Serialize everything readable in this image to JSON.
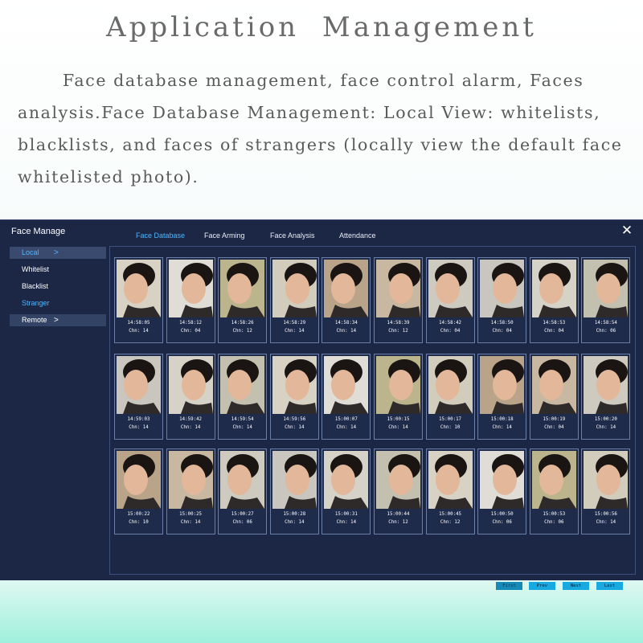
{
  "banner": {
    "title": "Application  Management",
    "description": "Face database management, face control alarm, Faces analysis.Face Database Management: Local View: whitelists, blacklists, and faces of strangers (locally view the default face whitelisted photo)."
  },
  "window": {
    "title": "Face Manage",
    "close_icon": "close-icon"
  },
  "tabs": [
    {
      "label": "Face Database",
      "active": true
    },
    {
      "label": "Face Arming",
      "active": false
    },
    {
      "label": "Face Analysis",
      "active": false
    },
    {
      "label": "Attendance",
      "active": false
    }
  ],
  "sidebar": {
    "items": [
      {
        "label": "Local",
        "chevron": ">"
      },
      {
        "label": "Whitelist"
      },
      {
        "label": "Blacklist"
      },
      {
        "label": "Stranger"
      },
      {
        "label": "Remote",
        "chevron": ">"
      }
    ]
  },
  "faces": [
    {
      "time": "14:58:05",
      "chn": "Chn: 14"
    },
    {
      "time": "14:58:12",
      "chn": "Chn: 04"
    },
    {
      "time": "14:58:26",
      "chn": "Chn: 12"
    },
    {
      "time": "14:58:29",
      "chn": "Chn: 14"
    },
    {
      "time": "14:58:34",
      "chn": "Chn: 14"
    },
    {
      "time": "14:58:39",
      "chn": "Chn: 12"
    },
    {
      "time": "14:58:42",
      "chn": "Chn: 04"
    },
    {
      "time": "14:58:50",
      "chn": "Chn: 04"
    },
    {
      "time": "14:58:53",
      "chn": "Chn: 04"
    },
    {
      "time": "14:58:54",
      "chn": "Chn: 06"
    },
    {
      "time": "14:59:03",
      "chn": "Chn: 14"
    },
    {
      "time": "14:59:42",
      "chn": "Chn: 14"
    },
    {
      "time": "14:59:54",
      "chn": "Chn: 14"
    },
    {
      "time": "14:59:56",
      "chn": "Chn: 14"
    },
    {
      "time": "15:00:07",
      "chn": "Chn: 14"
    },
    {
      "time": "15:00:15",
      "chn": "Chn: 14"
    },
    {
      "time": "15:00:17",
      "chn": "Chn: 10"
    },
    {
      "time": "15:00:18",
      "chn": "Chn: 14"
    },
    {
      "time": "15:00:19",
      "chn": "Chn: 04"
    },
    {
      "time": "15:00:20",
      "chn": "Chn: 14"
    },
    {
      "time": "15:00:22",
      "chn": "Chn: 10"
    },
    {
      "time": "15:00:25",
      "chn": "Chn: 14"
    },
    {
      "time": "15:00:27",
      "chn": "Chn: 06"
    },
    {
      "time": "15:00:28",
      "chn": "Chn: 14"
    },
    {
      "time": "15:00:31",
      "chn": "Chn: 14"
    },
    {
      "time": "15:00:44",
      "chn": "Chn: 12"
    },
    {
      "time": "15:00:45",
      "chn": "Chn: 12"
    },
    {
      "time": "15:00:50",
      "chn": "Chn: 06"
    },
    {
      "time": "15:00:53",
      "chn": "Chn: 06"
    },
    {
      "time": "15:00:56",
      "chn": "Chn: 14"
    }
  ],
  "pagination": {
    "first": "First",
    "prev": "Prev",
    "next": "Next",
    "last": "Last"
  },
  "colors": {
    "window_bg": "#1b2745",
    "accent": "#4eb6ff",
    "button": "#18a9e0"
  }
}
